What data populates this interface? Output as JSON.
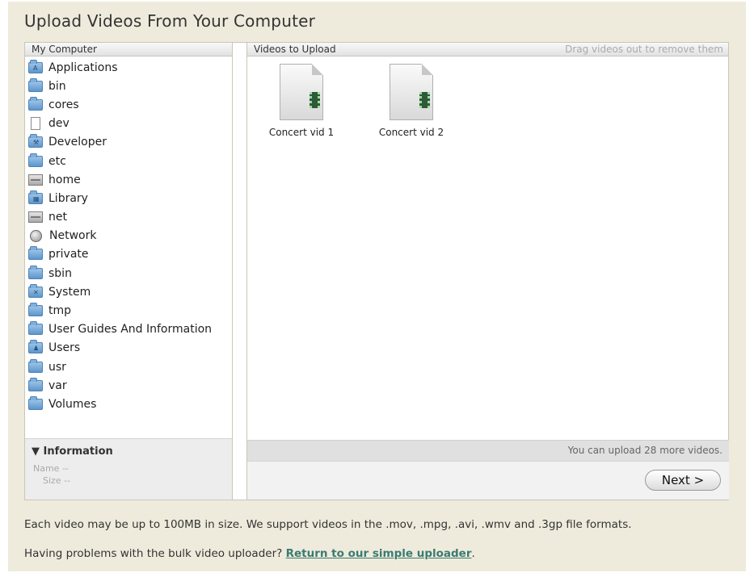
{
  "title": "Upload Videos From Your Computer",
  "left_pane": {
    "header": "My Computer",
    "items": [
      {
        "label": "Applications",
        "icon": "applications-folder-icon"
      },
      {
        "label": "bin",
        "icon": "folder-icon"
      },
      {
        "label": "cores",
        "icon": "folder-icon"
      },
      {
        "label": "dev",
        "icon": "document-icon"
      },
      {
        "label": "Developer",
        "icon": "developer-folder-icon"
      },
      {
        "label": "etc",
        "icon": "folder-icon"
      },
      {
        "label": "home",
        "icon": "drive-icon"
      },
      {
        "label": "Library",
        "icon": "library-folder-icon"
      },
      {
        "label": "net",
        "icon": "drive-icon"
      },
      {
        "label": "Network",
        "icon": "network-globe-icon"
      },
      {
        "label": "private",
        "icon": "folder-icon"
      },
      {
        "label": "sbin",
        "icon": "folder-icon"
      },
      {
        "label": "System",
        "icon": "system-folder-icon"
      },
      {
        "label": "tmp",
        "icon": "folder-icon"
      },
      {
        "label": "User Guides And Information",
        "icon": "folder-icon"
      },
      {
        "label": "Users",
        "icon": "users-folder-icon"
      },
      {
        "label": "usr",
        "icon": "folder-icon"
      },
      {
        "label": "var",
        "icon": "folder-icon"
      },
      {
        "label": "Volumes",
        "icon": "folder-icon"
      }
    ],
    "info": {
      "title": "▼ Information",
      "name_label": "Name",
      "name_value": "--",
      "size_label": "Size",
      "size_value": "--"
    }
  },
  "right_pane": {
    "header": "Videos to Upload",
    "hint": "Drag videos out to remove them",
    "videos": [
      {
        "label": "Concert vid 1",
        "icon": "video-file-icon"
      },
      {
        "label": "Concert vid 2",
        "icon": "video-file-icon"
      }
    ],
    "status": "You can upload 28 more videos.",
    "next_label": "Next >"
  },
  "notes": {
    "size_note": "Each video may be up to 100MB in size. We support videos in the .mov, .mpg, .avi, .wmv and .3gp file formats.",
    "problem_text": "Having problems with the bulk video uploader?",
    "link_text": "Return to our simple uploader",
    "after_link": "."
  },
  "colors": {
    "page_bg": "#efebdc",
    "link": "#3a7b72",
    "folder": "#6fa3d6"
  }
}
